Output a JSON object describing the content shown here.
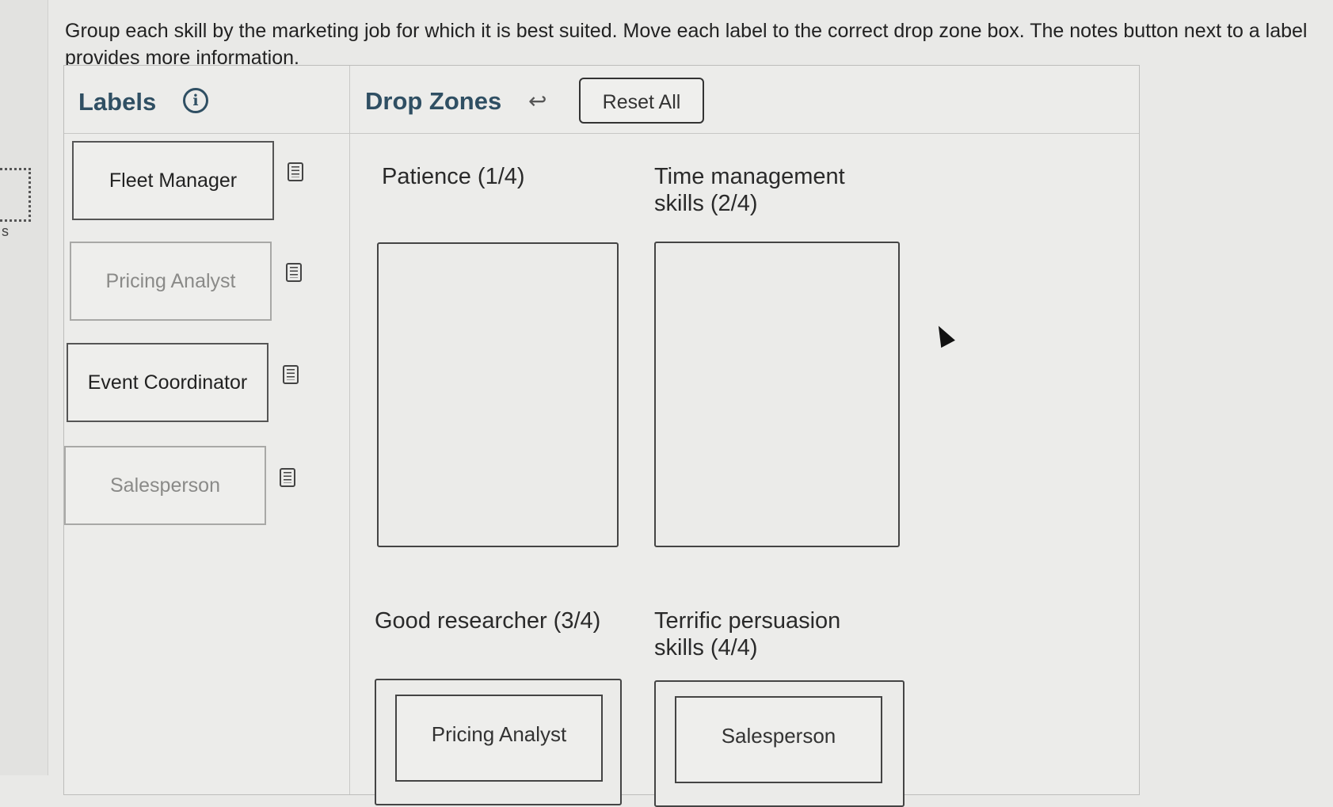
{
  "instructions": "Group each skill by the marketing job for which it is best suited. Move each label to the correct drop zone box. The notes button next to a label provides more information.",
  "labels_panel": {
    "title": "Labels",
    "info_icon": "info-icon",
    "items": [
      {
        "label": "Fleet Manager",
        "state": "available"
      },
      {
        "label": "Pricing Analyst",
        "state": "placed"
      },
      {
        "label": "Event Coordinator",
        "state": "available"
      },
      {
        "label": "Salesperson",
        "state": "placed"
      }
    ],
    "notes_icon": "notes-icon"
  },
  "drop_zones_panel": {
    "title": "Drop Zones",
    "undo_icon": "undo-arrow-icon",
    "reset_label": "Reset All",
    "zones": [
      {
        "label": "Patience (1/4)",
        "placed": ""
      },
      {
        "label": "Time management skills (2/4)",
        "placed": ""
      },
      {
        "label": "Good researcher (3/4)",
        "placed": "Pricing Analyst"
      },
      {
        "label": "Terrific persuasion skills (4/4)",
        "placed": "Salesperson"
      }
    ]
  },
  "left_edge": {
    "fragment": "s"
  }
}
